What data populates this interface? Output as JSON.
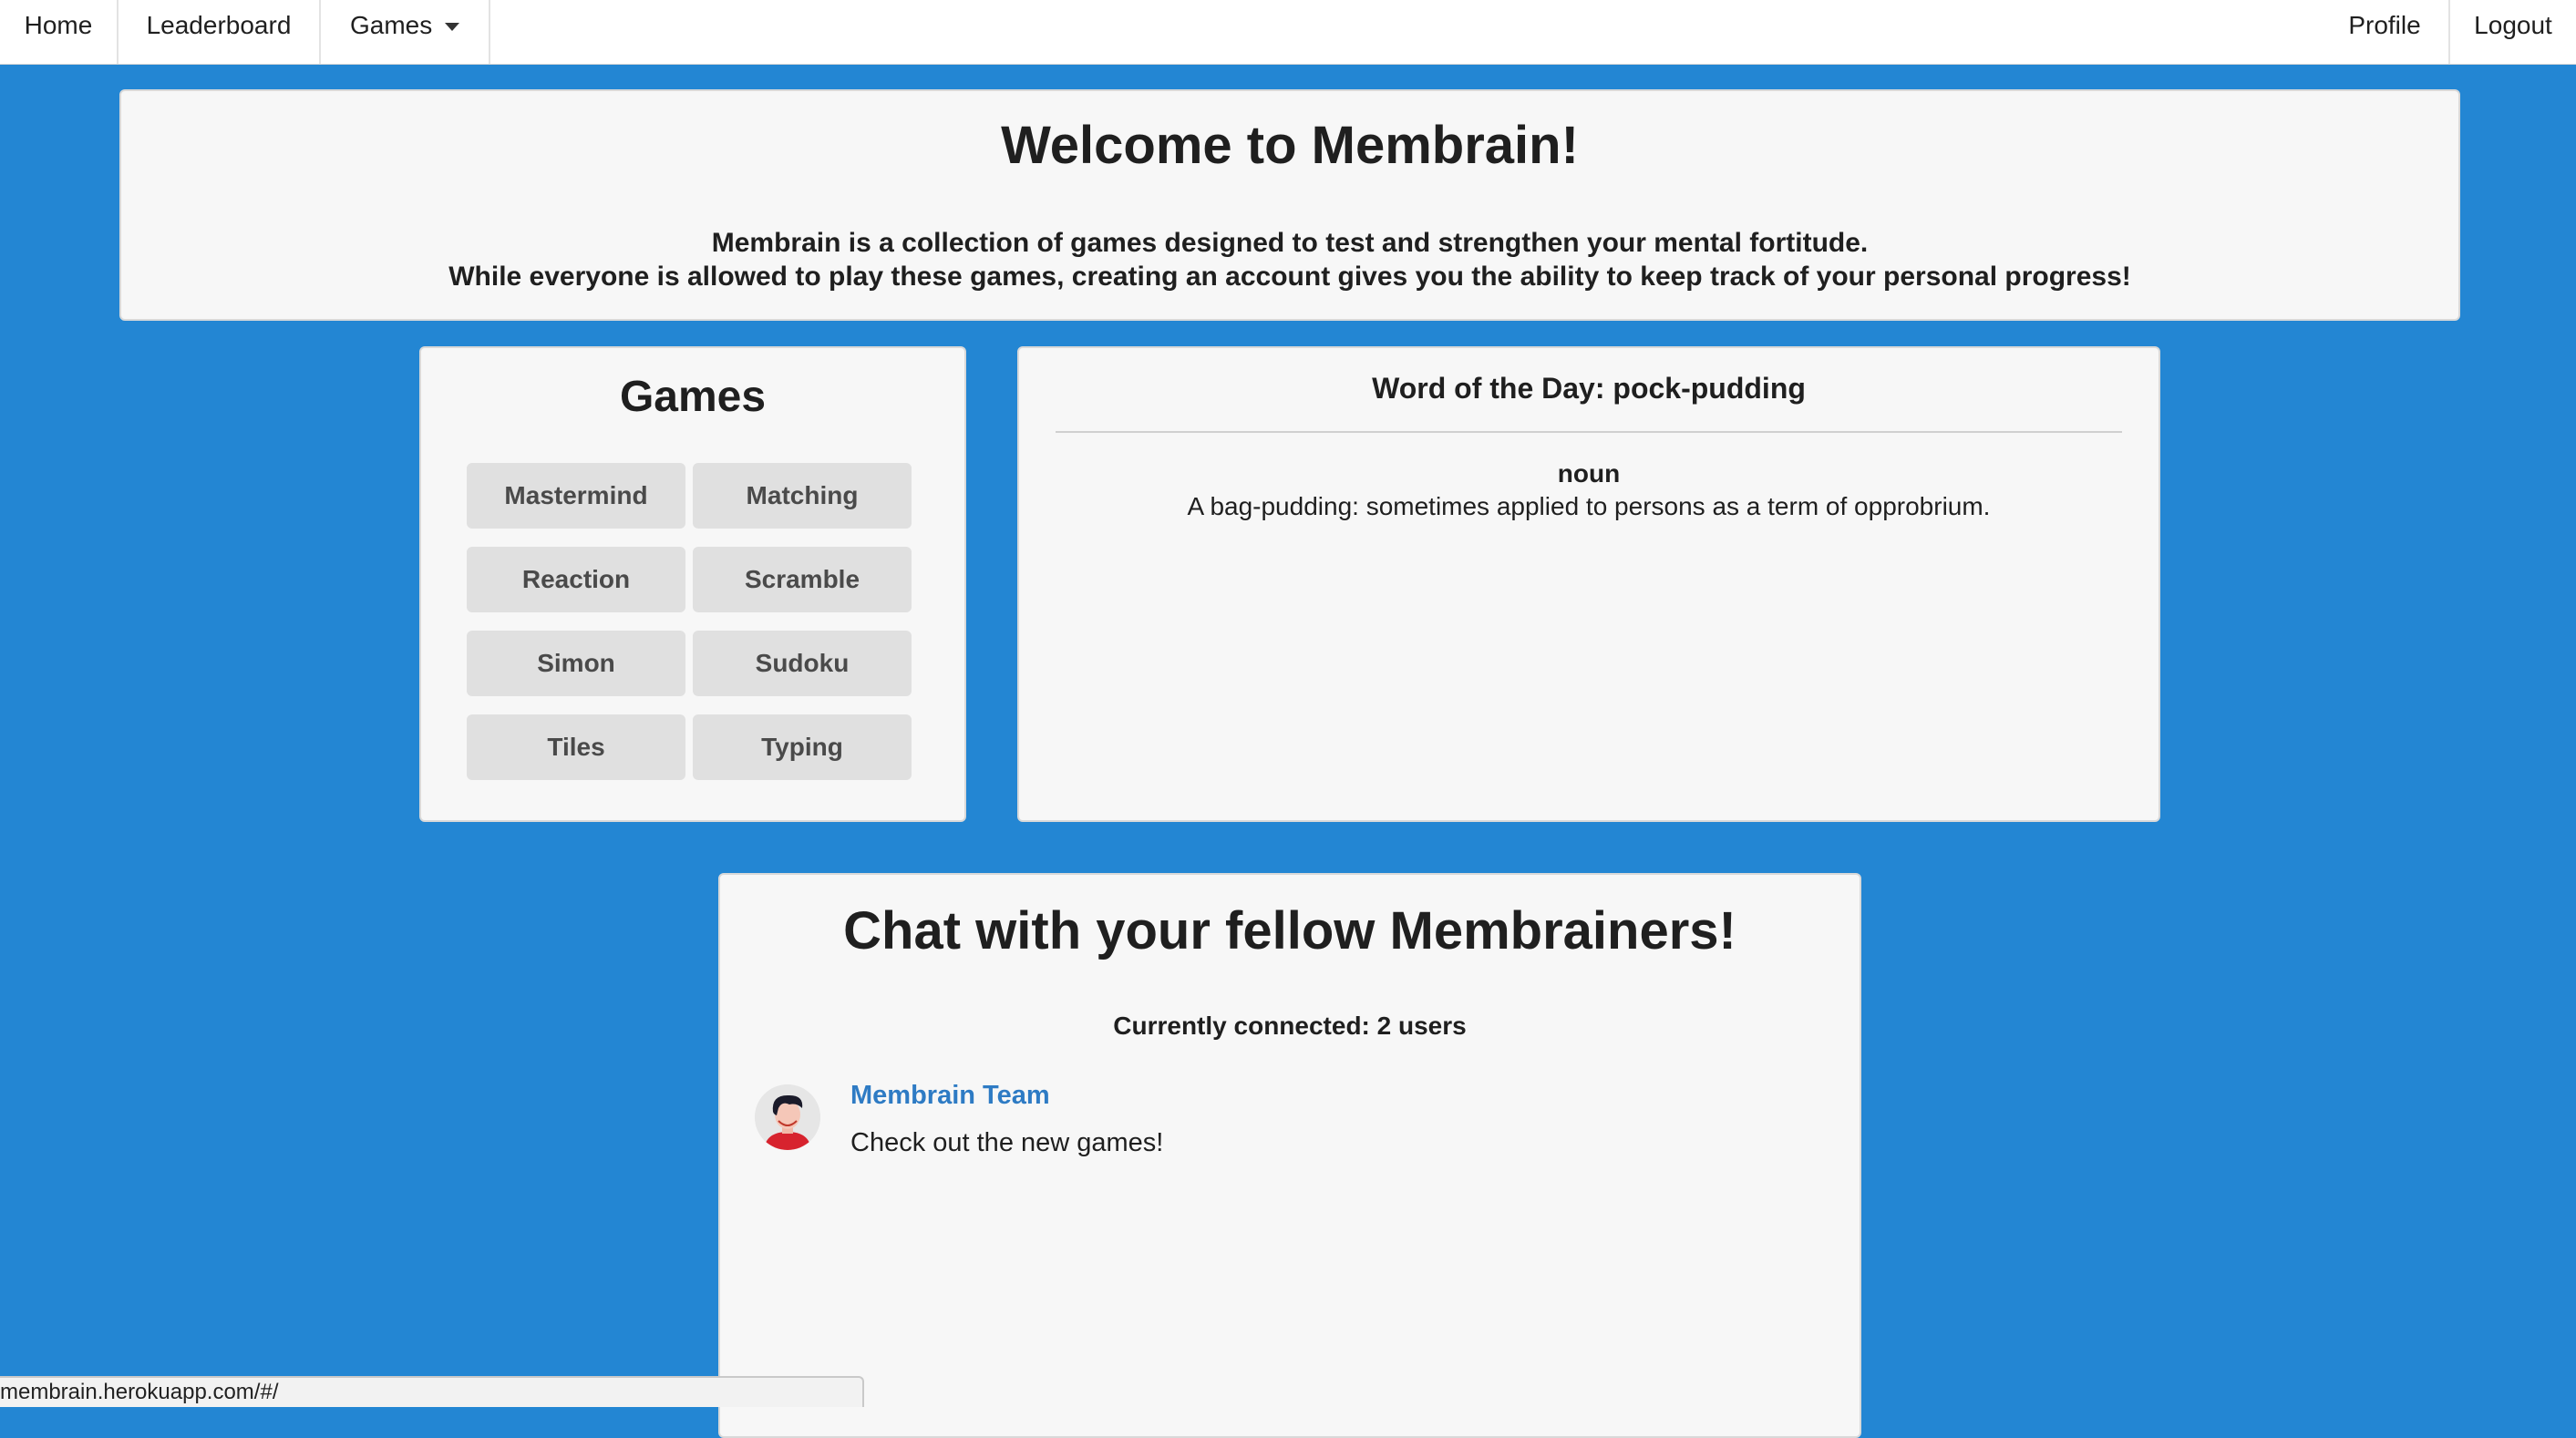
{
  "nav": {
    "home": "Home",
    "leaderboard": "Leaderboard",
    "games": "Games",
    "profile": "Profile",
    "logout": "Logout"
  },
  "welcome": {
    "title": "Welcome to Membrain!",
    "line1": "Membrain is a collection of games designed to test and strengthen your mental fortitude.",
    "line2": "While everyone is allowed to play these games, creating an account gives you the ability to keep track of your personal progress!"
  },
  "games_panel": {
    "title": "Games",
    "buttons": [
      "Mastermind",
      "Matching",
      "Reaction",
      "Scramble",
      "Simon",
      "Sudoku",
      "Tiles",
      "Typing"
    ]
  },
  "word_of_day": {
    "title": "Word of the Day: pock-pudding",
    "part_of_speech": "noun",
    "definition": "A bag-pudding: sometimes applied to persons as a term of opprobrium."
  },
  "chat": {
    "title": "Chat with your fellow Membrainers!",
    "connected": "Currently connected: 2 users",
    "messages": [
      {
        "author": "Membrain Team",
        "text": "Check out the new games!",
        "avatar_icon": "user-avatar-icon"
      }
    ]
  },
  "status_bar": {
    "url": "membrain.herokuapp.com/#/"
  },
  "colors": {
    "background": "#2386d3",
    "panel": "#f7f7f7",
    "button": "#e0e0e0",
    "link": "#2e7bc4"
  }
}
